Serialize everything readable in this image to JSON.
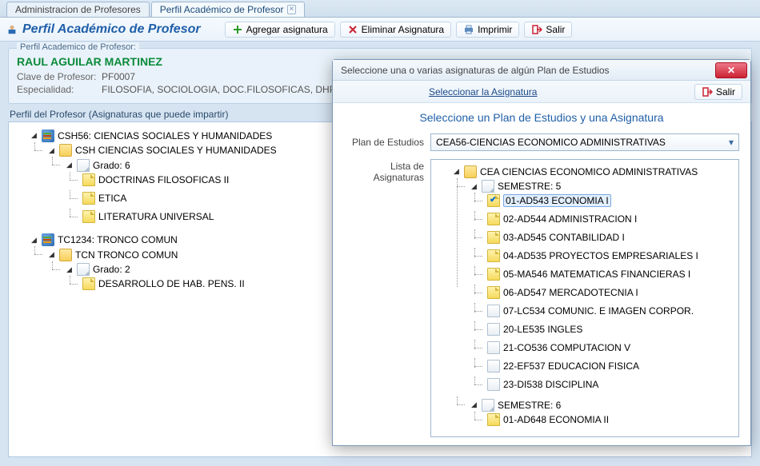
{
  "tabs": {
    "t0": "Administracion de Profesores",
    "t1": "Perfil Académico de Profesor"
  },
  "header": {
    "title": "Perfil Académico de Profesor"
  },
  "toolbar": {
    "add": "Agregar asignatura",
    "del": "Eliminar Asignatura",
    "print": "Imprimir",
    "exit": "Salir"
  },
  "groupbox": {
    "legend": "Perfil Academico de Profesor:"
  },
  "prof": {
    "name": "RAUL AGUILAR MARTINEZ",
    "clave_lbl": "Clave de Profesor:",
    "clave": "PF0007",
    "esp_lbl": "Especialidad:",
    "esp": "FILOSOFIA, SOCIOLOGIA, DOC.FILOSOFICAS, DHP"
  },
  "section_label": "Perfil del Profesor (Asignaturas que puede impartir)",
  "tree_left": {
    "r0": "CSH56: CIENCIAS SOCIALES Y HUMANIDADES",
    "r0c0": "CSH CIENCIAS SOCIALES Y HUMANIDADES",
    "r0g": "Grado: 6",
    "r0s0": "DOCTRINAS FILOSOFICAS II",
    "r0s1": "ETICA",
    "r0s2": "LITERATURA UNIVERSAL",
    "r1": "TC1234: TRONCO COMUN",
    "r1c0": "TCN TRONCO COMUN",
    "r1g": "Grado: 2",
    "r1s0": "DESARROLLO DE HAB. PENS. II"
  },
  "dialog": {
    "title": "Seleccione una o varias asignaturas de algún Plan de Estudios",
    "select_link": "Seleccionar la Asignatura",
    "exit": "Salir",
    "heading": "Seleccione un Plan de Estudios y una Asignatura",
    "plan_lbl": "Plan de Estudios",
    "plan_value": "CEA56-CIENCIAS ECONOMICO ADMINISTRATIVAS",
    "list_lbl": "Lista de Asignaturas",
    "root": "CEA CIENCIAS ECONOMICO ADMINISTRATIVAS",
    "sem5": "SEMESTRE: 5",
    "s5": {
      "i0": "01-AD543 ECONOMIA I",
      "i1": "02-AD544 ADMINISTRACION I",
      "i2": "03-AD545 CONTABILIDAD I",
      "i3": "04-AD535 PROYECTOS EMPRESARIALES I",
      "i4": "05-MA546 MATEMATICAS FINANCIERAS I",
      "i5": "06-AD547 MERCADOTECNIA I",
      "i6": "07-LC534 COMUNIC. E IMAGEN CORPOR.",
      "i7": "20-LE535 INGLES",
      "i8": "21-CO536 COMPUTACION V",
      "i9": "22-EF537 EDUCACION FISICA",
      "i10": "23-DI538 DISCIPLINA"
    },
    "sem6": "SEMESTRE: 6",
    "s6": {
      "i0": "01-AD648 ECONOMIA II"
    }
  }
}
